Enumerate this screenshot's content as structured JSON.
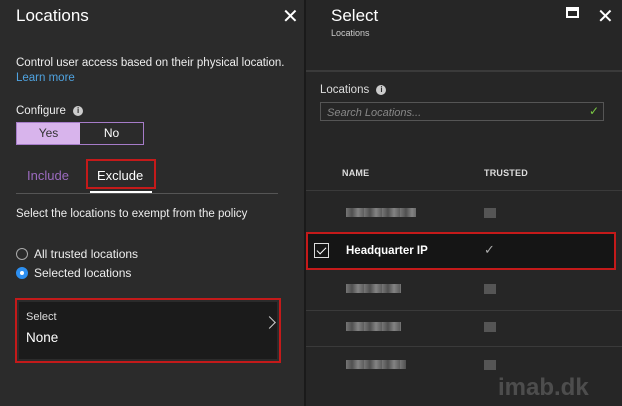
{
  "left_panel": {
    "title": "Locations",
    "description": "Control user access based on their physical location.",
    "learn_more": "Learn more",
    "configure_label": "Configure",
    "toggle": {
      "yes": "Yes",
      "no": "No",
      "selected": "Yes"
    },
    "tabs": {
      "include": "Include",
      "exclude": "Exclude",
      "active": "Exclude"
    },
    "exempt_text": "Select the locations to exempt from the policy",
    "radios": [
      {
        "label": "All trusted locations",
        "checked": false
      },
      {
        "label": "Selected locations",
        "checked": true
      }
    ],
    "select": {
      "label": "Select",
      "value": "None"
    }
  },
  "right_panel": {
    "title": "Select",
    "subtitle": "Locations",
    "locations_label": "Locations",
    "search_placeholder": "Search Locations...",
    "columns": {
      "name": "NAME",
      "trusted": "TRUSTED"
    },
    "selected_row": {
      "name": "Headquarter IP",
      "trusted": "✓",
      "checked": true
    }
  },
  "watermark": "imab.dk",
  "colors": {
    "accent_purple": "#a67cc9",
    "highlight_red": "#c41a1a",
    "radio_blue": "#2d8ff0",
    "valid_green": "#7ac943"
  },
  "icons": [
    "close-icon",
    "maximize-icon",
    "info-icon",
    "chevron-right-icon",
    "check-icon"
  ]
}
